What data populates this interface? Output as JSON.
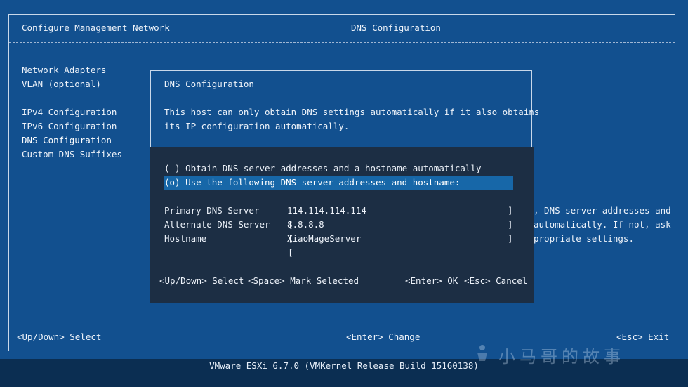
{
  "header": {
    "left_title": "Configure Management Network",
    "right_title": "DNS Configuration"
  },
  "sidebar": {
    "items": [
      {
        "label": "Network Adapters"
      },
      {
        "label": "VLAN (optional)"
      },
      {
        "label": "IPv4 Configuration"
      },
      {
        "label": "IPv6 Configuration"
      },
      {
        "label": "DNS Configuration"
      },
      {
        "label": "Custom DNS Suffixes"
      }
    ]
  },
  "background_text": {
    "line1": ", DNS server addresses and",
    "line2": "automatically. If not, ask",
    "line3": "propriate settings."
  },
  "dialog": {
    "title": "DNS Configuration",
    "description_line1": "This host can only obtain DNS settings automatically if it also obtains",
    "description_line2": "its IP configuration automatically.",
    "option_auto": "( ) Obtain DNS server addresses and a hostname automatically",
    "option_manual": "(o) Use the following DNS server addresses and hostname:",
    "fields": {
      "primary": {
        "label": "Primary DNS Server",
        "value": "114.114.114.114"
      },
      "alternate": {
        "label": "Alternate DNS Server",
        "value": "8.8.8.8"
      },
      "hostname": {
        "label": "Hostname",
        "value": "XiaoMageServer"
      }
    },
    "hint_select": "<Up/Down> Select",
    "hint_mark": "<Space> Mark Selected",
    "hint_ok": "<Enter> OK",
    "hint_cancel": "<Esc> Cancel"
  },
  "statusbar": {
    "select": "<Up/Down> Select",
    "change": "<Enter> Change",
    "exit": "<Esc> Exit"
  },
  "footer": {
    "version": "VMware ESXi 6.7.0 (VMKernel Release Build 15160138)"
  },
  "watermark": {
    "text": "小马哥的故事"
  },
  "colors": {
    "background": "#12508f",
    "dialog_background": "#1c2e44",
    "selection": "#1767a8",
    "footer": "#0b2e52"
  }
}
